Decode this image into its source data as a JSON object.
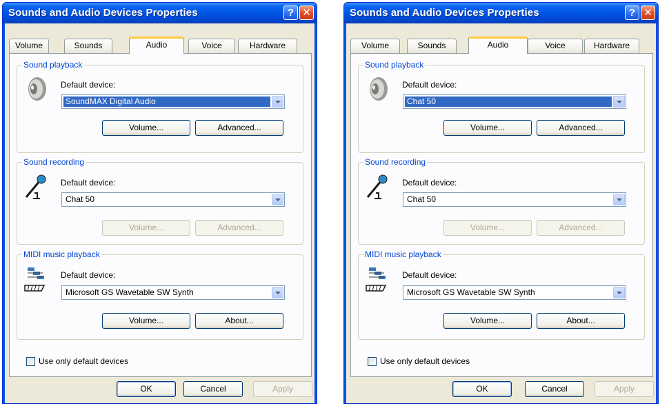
{
  "windows": [
    {
      "title": "Sounds and Audio Devices Properties",
      "tabs": [
        "Volume",
        "Sounds",
        "Audio",
        "Voice",
        "Hardware"
      ],
      "active_tab": "Audio",
      "playback": {
        "group_label": "Sound playback",
        "device_label": "Default device:",
        "device_value": "SoundMAX Digital Audio",
        "volume_button": "Volume...",
        "advanced_button": "Advanced..."
      },
      "recording": {
        "group_label": "Sound recording",
        "device_label": "Default device:",
        "device_value": "Chat 50",
        "volume_button": "Volume...",
        "advanced_button": "Advanced..."
      },
      "midi": {
        "group_label": "MIDI music playback",
        "device_label": "Default device:",
        "device_value": "Microsoft GS Wavetable SW Synth",
        "volume_button": "Volume...",
        "about_button": "About..."
      },
      "use_default_label": "Use only default devices",
      "ok_button": "OK",
      "cancel_button": "Cancel",
      "apply_button": "Apply"
    },
    {
      "title": "Sounds and Audio Devices Properties",
      "tabs": [
        "Volume",
        "Sounds",
        "Audio",
        "Voice",
        "Hardware"
      ],
      "active_tab": "Audio",
      "playback": {
        "group_label": "Sound playback",
        "device_label": "Default device:",
        "device_value": "Chat 50",
        "volume_button": "Volume...",
        "advanced_button": "Advanced..."
      },
      "recording": {
        "group_label": "Sound recording",
        "device_label": "Default device:",
        "device_value": "Chat 50",
        "volume_button": "Volume...",
        "advanced_button": "Advanced..."
      },
      "midi": {
        "group_label": "MIDI music playback",
        "device_label": "Default device:",
        "device_value": "Microsoft GS Wavetable SW Synth",
        "volume_button": "Volume...",
        "about_button": "About..."
      },
      "use_default_label": "Use only default devices",
      "ok_button": "OK",
      "cancel_button": "Cancel",
      "apply_button": "Apply"
    }
  ],
  "icons": {
    "title_help": "help-icon",
    "title_close": "close-icon",
    "playback": "speaker-icon",
    "recording": "microphone-icon",
    "midi": "midi-keyboard-icon",
    "dropdown": "chevron-down-icon"
  },
  "colors": {
    "titlebar": "#0054e3",
    "group_title": "#0046d5",
    "selection": "#316ac5",
    "active_tab_accent": "#ffc83c",
    "dialog_face": "#ece9d8"
  }
}
